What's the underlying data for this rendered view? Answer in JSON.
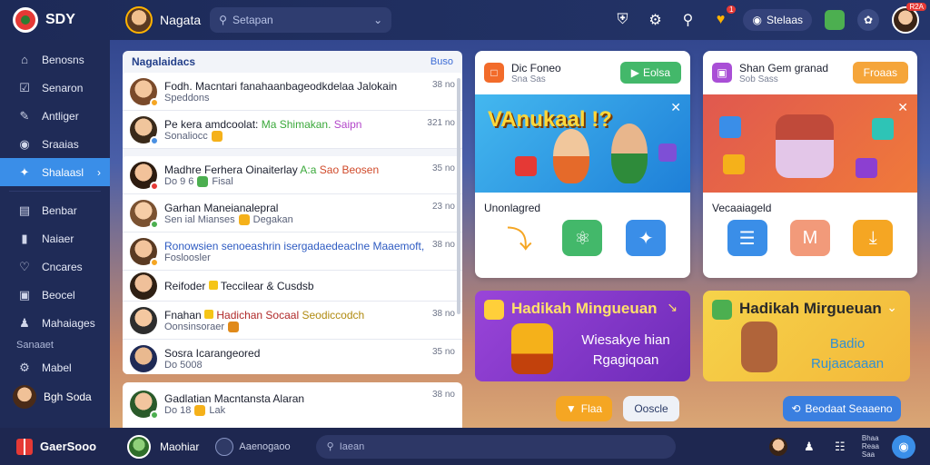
{
  "brand": {
    "name": "SDY"
  },
  "topbar": {
    "username": "Nagata",
    "search_placeholder": "Setapan",
    "status_pill": "Stelaas",
    "badge_count": "1",
    "profile_badge": "R2A"
  },
  "sidebar": {
    "items": [
      {
        "label": "Benosns",
        "icon": "home-icon"
      },
      {
        "label": "Senaron",
        "icon": "check-icon"
      },
      {
        "label": "Antliger",
        "icon": "edit-icon"
      },
      {
        "label": "Sraaias",
        "icon": "gamepad-icon"
      },
      {
        "label": "Shalaasl",
        "icon": "bird-icon"
      },
      {
        "label": "Benbar",
        "icon": "chat-icon"
      },
      {
        "label": "Naiaer",
        "icon": "bookmark-icon"
      },
      {
        "label": "Cncares",
        "icon": "heart-icon"
      },
      {
        "label": "Beocel",
        "icon": "document-icon"
      },
      {
        "label": "Mahaiages",
        "icon": "person-icon"
      }
    ],
    "section_label": "Sanaaet",
    "extra_item": {
      "label": "Mabel",
      "icon": "gear-icon"
    },
    "user": {
      "label": "Bgh Soda"
    }
  },
  "list": {
    "header": "Nagalaidacs",
    "more": "Buso",
    "items": [
      {
        "title": "Fodh. Macntari fanahaanbageodkdelaa Jalokain",
        "sub": "Speddons",
        "time": "38 no",
        "highlight": "",
        "highlight2": "",
        "title_rest": ""
      },
      {
        "title": "Pe kera amdcoolat:",
        "highlight": "Ma Shimakan.",
        "highlight2": "Saipn",
        "title_rest": "",
        "sub": "Sonaliocc",
        "time": "321 no"
      },
      {
        "title": "Madhre Ferhera Oinaiterlay",
        "highlight": "A:a",
        "highlight2": "",
        "title_rest": "Sao Beosen",
        "sub": "Do 9 6",
        "sub_chip": "Fisal",
        "time": "35 no"
      },
      {
        "title": "Garhan Maneianalepral",
        "sub": "Sen ial Mianses",
        "sub_chip": "Degakan",
        "time": "23 no",
        "highlight": "",
        "highlight2": ""
      },
      {
        "title": "Ronowsien senoeashrin isergadaedeaclne Maaemoft,",
        "sub": "Fosloosler",
        "time": "38 no",
        "highlight": "",
        "highlight2": ""
      },
      {
        "title": "Reifoder",
        "highlight": "",
        "title_rest": "Teccilear & Cusdsb",
        "sub": "",
        "time": "",
        "highlight2": ""
      },
      {
        "title": "Fnahan",
        "highlight": "Hadichan Socaal",
        "highlight2": "Seodiccodch",
        "sub": "Oonsinsoraer",
        "time": "38 no"
      },
      {
        "title": "Sosra Icarangeored",
        "sub": "Do 5008",
        "time": "35 no",
        "highlight": "",
        "highlight2": ""
      }
    ],
    "bottom_item": {
      "title": "Gadlatian Macntansta Alaran",
      "sub": "Do 18",
      "sub_chip": "Lak",
      "time": "38 no"
    }
  },
  "cards": [
    {
      "name": "Dic Foneo",
      "sub": "Sna Sas",
      "button": "Eolsa",
      "button_color": "#43b86a",
      "banner_title": "VAnukaal !?",
      "label": "Unonlagred",
      "icons": [
        "magnet-icon",
        "gamepad-icon",
        "twitter-icon"
      ]
    },
    {
      "name": "Shan Gem granad",
      "sub": "Sob Sass",
      "button": "Froaas",
      "button_color": "#f5a53a",
      "banner_title": "",
      "label": "Vecaaiageld",
      "icons": [
        "document-icon",
        "mail-icon",
        "download-icon"
      ]
    }
  ],
  "promos": [
    {
      "title": "Hadikah Mingueuan",
      "sub_line1": "Wiesakye hian",
      "sub_line2": "Rgagiqoan"
    },
    {
      "title": "Hadikah Mirgueuan",
      "sub_line1": "Badio",
      "sub_line2": "Rujaacaaan"
    }
  ],
  "buttons": {
    "left": "Flaa",
    "middle": "Ooscle",
    "right": "Beodaat Seaaeno"
  },
  "bottombar": {
    "brand": "GaerSooo",
    "username": "Maohiar",
    "secondary": "Aaenogaoo",
    "search_placeholder": "Iaean",
    "stats_line1": "Bhaa",
    "stats_line2": "Reaa",
    "stats_line3": "Saa"
  },
  "colors": {
    "accent": "#3a8ee8",
    "sidebar": "#1f2b57",
    "promo_purple": "#8c3fd1",
    "promo_yellow": "#f6d34a"
  }
}
